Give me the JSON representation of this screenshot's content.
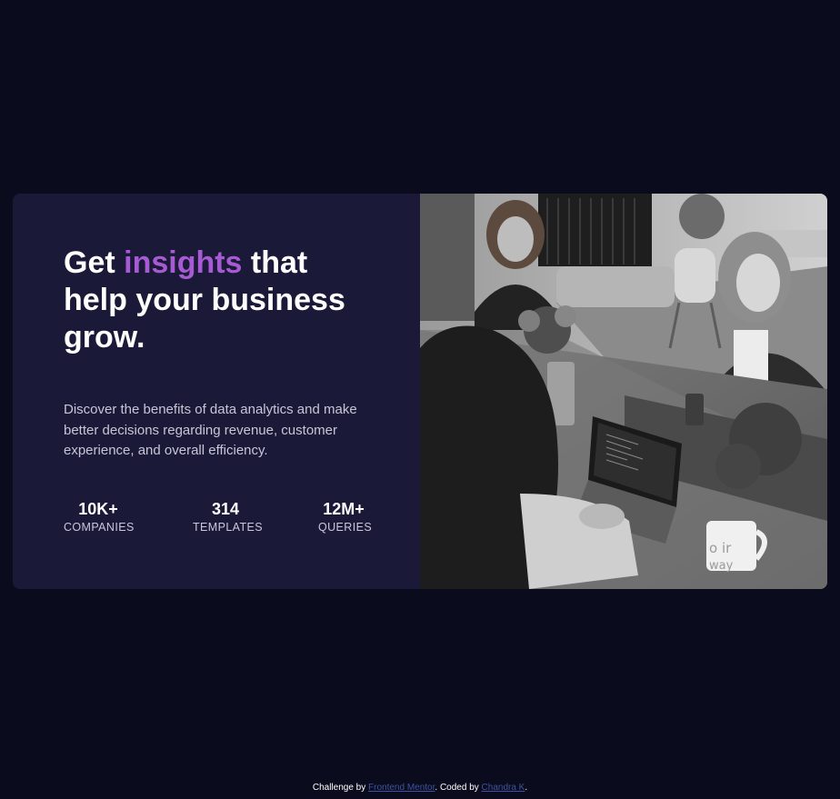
{
  "hero": {
    "headline_before": "Get ",
    "headline_accent": "insights",
    "headline_after": " that help your business grow.",
    "description": "Discover the benefits of data analytics and make better decisions regarding revenue, customer experience, and overall efficiency."
  },
  "stats": [
    {
      "value": "10K+",
      "label": "COMPANIES"
    },
    {
      "value": "314",
      "label": "TEMPLATES"
    },
    {
      "value": "12M+",
      "label": "QUERIES"
    }
  ],
  "image": {
    "alt": "Three women working at a table with laptops",
    "mug_text_1": "o ir",
    "mug_text_2": "way"
  },
  "footer": {
    "prefix": "Challenge by ",
    "challenge_link": "Frontend Mentor",
    "middle": ". Coded by ",
    "author_link": "Chandra K",
    "suffix": "."
  },
  "colors": {
    "page_bg": "#0a0c1d",
    "card_bg": "#1b1938",
    "accent": "#a65bd4",
    "link": "#3e52a3"
  }
}
